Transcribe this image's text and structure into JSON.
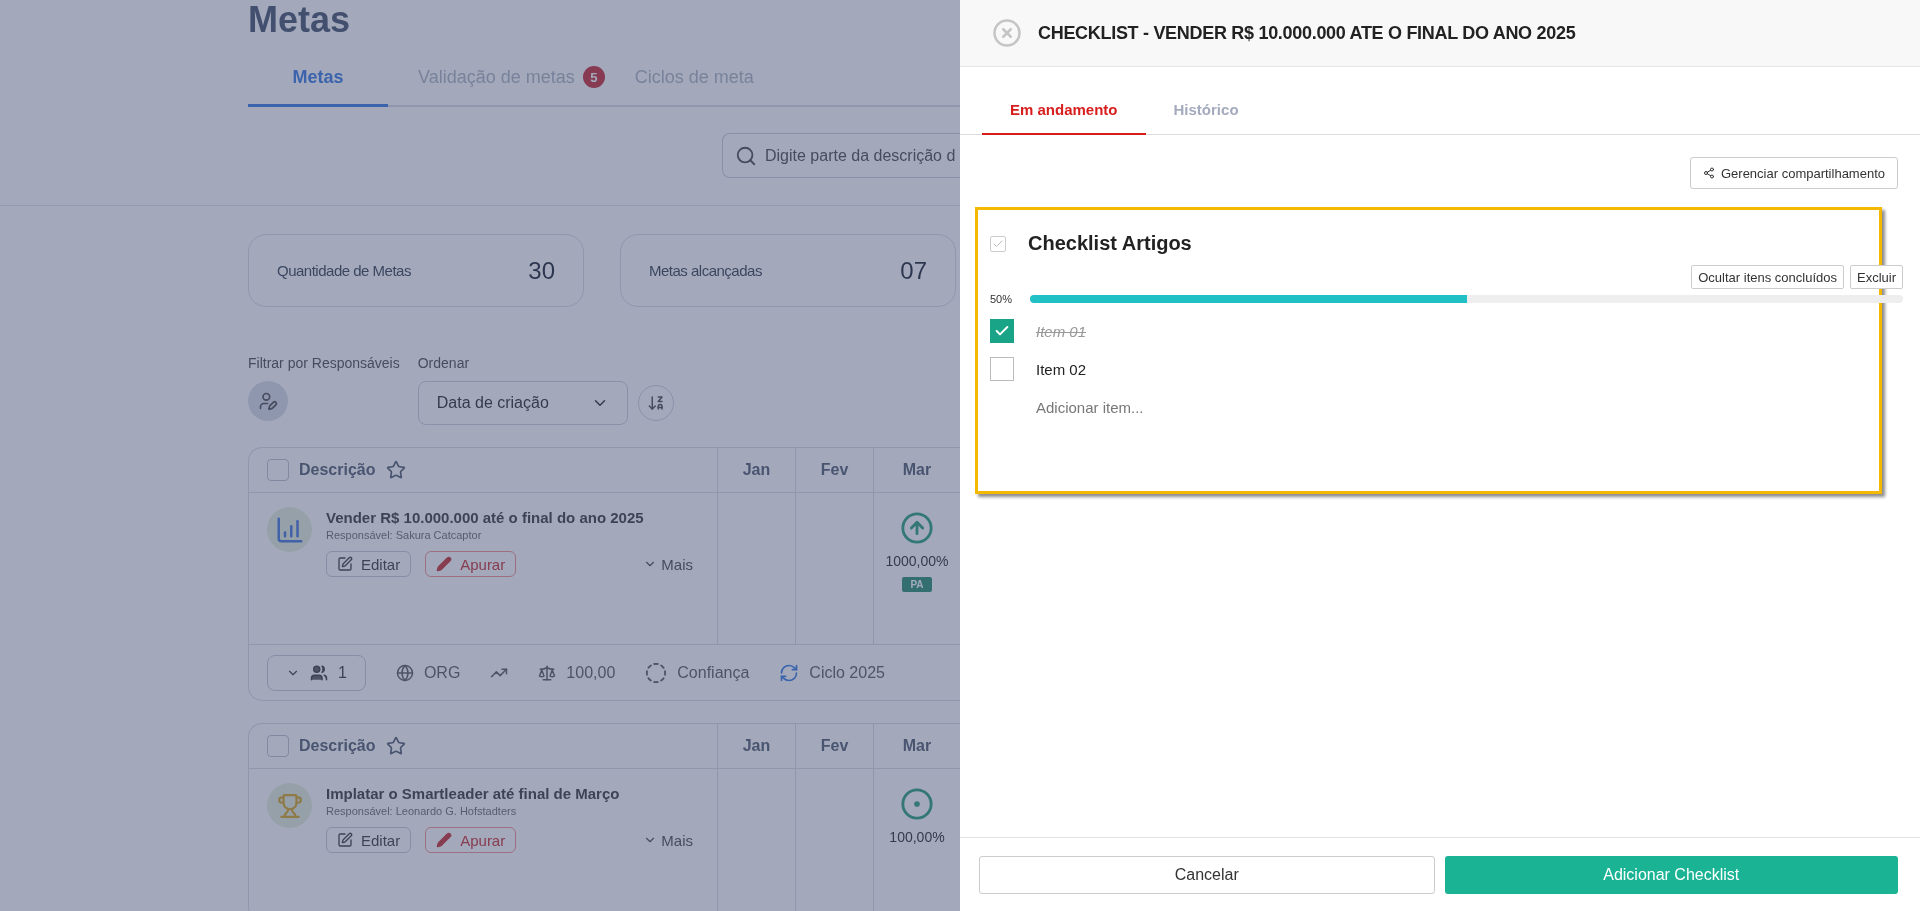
{
  "page": {
    "title": "Metas",
    "tabs": [
      {
        "label": "Metas",
        "selected": true
      },
      {
        "label": "Validação de metas",
        "selected": false,
        "badge": "5"
      },
      {
        "label": "Ciclos de meta",
        "selected": false
      }
    ],
    "search": {
      "placeholder": "Digite parte da descrição d"
    },
    "stats": [
      {
        "label": "Quantidade de Metas",
        "value": "30"
      },
      {
        "label": "Metas alcançadas",
        "value": "07"
      }
    ],
    "filter_label": "Filtrar por Responsáveis",
    "sort_label": "Ordenar",
    "sort_value": "Data de criação",
    "goals": [
      {
        "columns": [
          "Descrição",
          "Jan",
          "Fev",
          "Mar"
        ],
        "title": "Vender R$ 10.000.000 até o final do ano 2025",
        "responsible": "Responsável: Sakura Catcaptor",
        "kind": "chart",
        "checked": false,
        "edit": "Editar",
        "apurar": "Apurar",
        "more": "Mais",
        "mar": {
          "kind": "up",
          "value": "1000,00%",
          "badge": "PA"
        },
        "footer": {
          "participants": "1",
          "scope": "ORG",
          "weight": "100,00",
          "confidence": "Confiança",
          "cycle": "Ciclo 2025"
        }
      },
      {
        "columns": [
          "Descrição",
          "Jan",
          "Fev",
          "Mar"
        ],
        "title": "Implatar o Smartleader até final de Março",
        "responsible": "Responsável: Leonardo G. Hofstadters",
        "kind": "trophy",
        "checked": false,
        "edit": "Editar",
        "apurar": "Apurar",
        "more": "Mais",
        "mar": {
          "kind": "target",
          "value": "100,00%"
        }
      }
    ]
  },
  "panel": {
    "title": "CHECKLIST - VENDER R$ 10.000.000 ATE O FINAL DO ANO 2025",
    "tabs": [
      {
        "label": "Em andamento",
        "selected": true
      },
      {
        "label": "Histórico",
        "selected": false
      }
    ],
    "share_button": "Gerenciar compartilhamento",
    "checklist": {
      "title": "Checklist Artigos",
      "checked": true,
      "hide_button": "Ocultar itens concluídos",
      "delete_button": "Excluir",
      "progress_label": "50%",
      "level": 0.5,
      "items": [
        {
          "label": "Item 01",
          "checked": true
        },
        {
          "label": "Item 02",
          "checked": false
        }
      ],
      "add_placeholder": "Adicionar item..."
    },
    "cancel_button": "Cancelar",
    "submit_button": "Adicionar Checklist"
  }
}
